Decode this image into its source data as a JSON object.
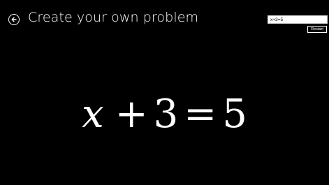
{
  "header": {
    "title": "Create your own problem"
  },
  "controls": {
    "equation_value": "x+3=5",
    "restart_label": "Restart"
  },
  "equation": {
    "variable": "x",
    "operator": "+",
    "constant": "3",
    "equals": "=",
    "result": "5"
  },
  "icons": {
    "back": "back-arrow-circle-icon"
  },
  "colors": {
    "background": "#000000",
    "foreground": "#ffffff"
  }
}
